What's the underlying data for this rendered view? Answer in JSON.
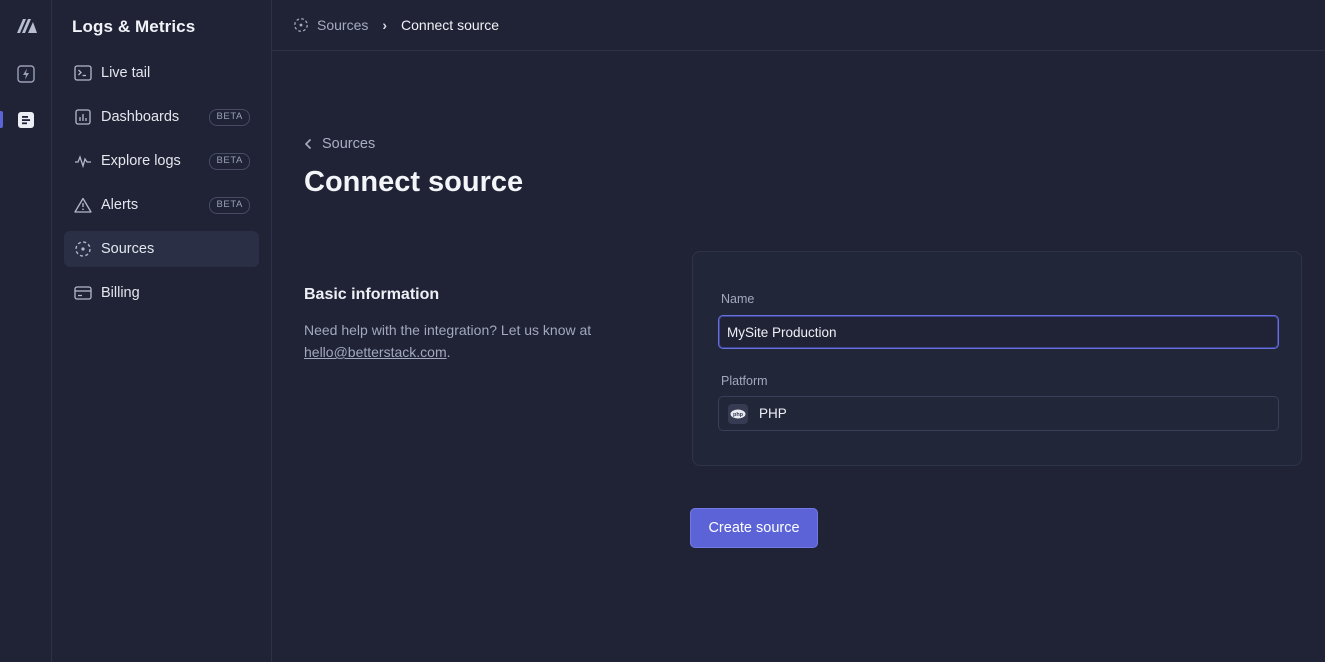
{
  "app": {
    "section_title": "Logs & Metrics"
  },
  "sidebar": {
    "items": [
      {
        "label": "Live tail",
        "icon": "terminal-icon",
        "badge": ""
      },
      {
        "label": "Dashboards",
        "icon": "bar-chart-icon",
        "badge": "BETA"
      },
      {
        "label": "Explore logs",
        "icon": "waveform-icon",
        "badge": "BETA"
      },
      {
        "label": "Alerts",
        "icon": "warning-triangle-icon",
        "badge": "BETA"
      },
      {
        "label": "Sources",
        "icon": "sources-icon",
        "badge": "",
        "active": true
      },
      {
        "label": "Billing",
        "icon": "credit-card-icon",
        "badge": ""
      }
    ]
  },
  "breadcrumb": {
    "parent": "Sources",
    "current": "Connect source"
  },
  "page": {
    "back_label": "Sources",
    "title": "Connect source"
  },
  "basic_info": {
    "title": "Basic information",
    "help_prefix": "Need help with the integration? Let us know at ",
    "help_email": "hello@betterstack.com",
    "help_suffix": "."
  },
  "form": {
    "name_label": "Name",
    "name_value": "MySite Production",
    "platform_label": "Platform",
    "platform_value": "PHP",
    "platform_icon_text": "php"
  },
  "actions": {
    "create_label": "Create source"
  },
  "colors": {
    "background": "#1f2335",
    "accent": "#5c63d6",
    "card": "#222639"
  }
}
